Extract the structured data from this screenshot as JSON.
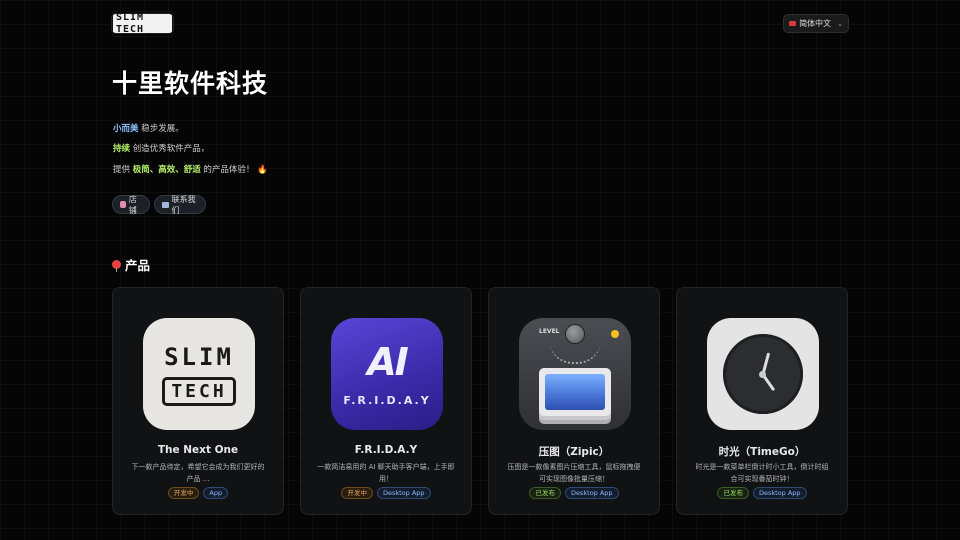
{
  "header": {
    "logo_text": "SLIM TECH",
    "language": "简体中文"
  },
  "hero": {
    "title": "十里软件科技",
    "line1": {
      "highlight": "小而美",
      "text": " 稳步发展。"
    },
    "line2": {
      "highlight": "持续",
      "text": " 创造优秀软件产品，"
    },
    "line3": {
      "prefix": "提供 ",
      "highlight": "极简、高效、舒适",
      "suffix": " 的产品体验！",
      "emoji": "🔥"
    },
    "buttons": [
      {
        "label": "店铺",
        "icon": "store-icon"
      },
      {
        "label": "联系我们",
        "icon": "contact-icon"
      }
    ]
  },
  "products_section": {
    "title": "产品",
    "icon": "pin-icon"
  },
  "products": [
    {
      "name": "The Next One",
      "desc": "下一款产品待定，希望它会成为我们更好的产品 ...",
      "tags": [
        "开发中",
        "App"
      ],
      "icon": "slim-tech-logo"
    },
    {
      "name": "F.R.I.D.A.Y",
      "desc": "一款简洁易用的 AI 聊天助手客户端，上手即用！",
      "tags": [
        "开发中",
        "Desktop App"
      ],
      "icon": "friday-ai-logo",
      "icon_text": "AI",
      "icon_sub": "F.R.I.D.A.Y"
    },
    {
      "name": "压图（Zipic）",
      "desc": "压图是一款像素图片压缩工具，鼠标拖拽便可实现图像批量压缩！",
      "tags": [
        "已发布",
        "Desktop App"
      ],
      "icon": "zipic-logo",
      "icon_text": "LEVEL"
    },
    {
      "name": "时光（TimeGo）",
      "desc": "时光是一款菜单栏倒计时小工具，倒计时组合可实现番茄时钟！",
      "tags": [
        "已发布",
        "Desktop App"
      ],
      "icon": "clock-logo"
    }
  ]
}
